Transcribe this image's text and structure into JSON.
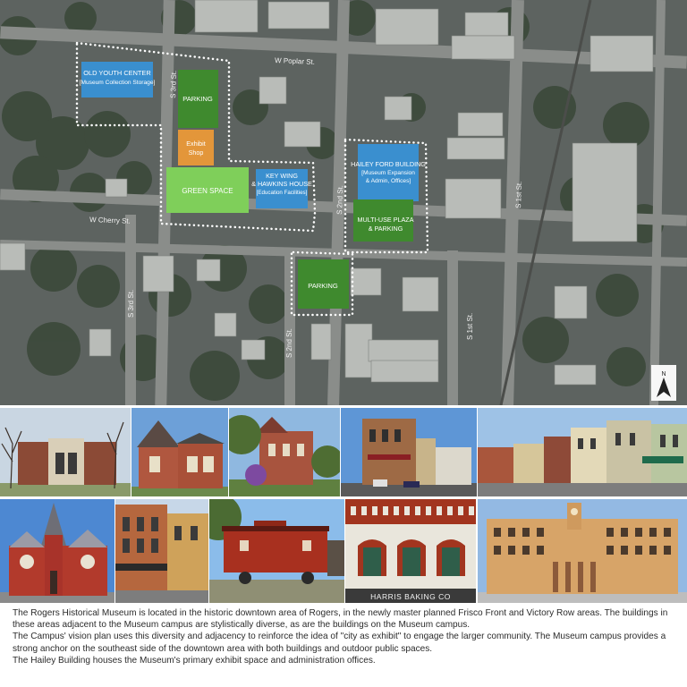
{
  "map": {
    "streets": {
      "poplar": "W Poplar St.",
      "cherry": "W Cherry St.",
      "third_upper": "S 3rd St.",
      "third_lower": "S 3rd St.",
      "second_upper": "S 2nd St.",
      "second_lower": "S 2nd St.",
      "first_mid": "S 1st St.",
      "first_right": "S 1st St."
    },
    "zones": {
      "old_youth_center": {
        "line1": "OLD YOUTH CENTER",
        "line2": "[Museum Collection Storage]",
        "color": "#3a8fcf"
      },
      "parking_north": {
        "line1": "PARKING",
        "color": "#3f8a2e"
      },
      "exhibit_shop": {
        "line1": "Exhibit",
        "line2": "Shop",
        "color": "#e3963a"
      },
      "green_space": {
        "line1": "GREEN SPACE",
        "color": "#7fcf5a"
      },
      "key_wing": {
        "line1": "KEY WING",
        "line2": "& HAWKINS HOUSE",
        "line3": "[Education Facilities]",
        "color": "#3a8fcf"
      },
      "hailey_ford": {
        "line1": "HAILEY FORD BUILDING",
        "line2": "[Museum Expansion",
        "line3": "& Admin, Offices]",
        "color": "#3a8fcf"
      },
      "multi_use": {
        "line1": "MULTI-USE PLAZA",
        "line2": "& PARKING",
        "color": "#3f8a2e"
      },
      "parking_south": {
        "line1": "PARKING",
        "color": "#3f8a2e"
      }
    },
    "north_arrow": "N"
  },
  "photos": [
    {
      "name": "photo-library-building"
    },
    {
      "name": "photo-brick-house"
    },
    {
      "name": "photo-victorian-mansion"
    },
    {
      "name": "photo-downtown-corner-building"
    },
    {
      "name": "photo-main-street-row"
    },
    {
      "name": "photo-brick-church"
    },
    {
      "name": "photo-brick-storefronts"
    },
    {
      "name": "photo-red-caboose"
    },
    {
      "name": "photo-harris-baking-facade",
      "sign": "HARRIS BAKING CO"
    },
    {
      "name": "photo-hotel-building"
    }
  ],
  "caption": {
    "p1": "The Rogers Historical Museum is located in the historic downtown area of Rogers, in the newly master planned Frisco Front and Victory Row areas. The buildings in these areas adjacent to the Museum campus are stylistically diverse, as are the buildings on the Museum campus.",
    "p2": "The Campus' vision plan uses this diversity and adjacency to reinforce the idea of \"city as exhibit\" to engage the larger community. The Museum campus provides a strong anchor on the southeast side of the downtown area with both buildings and outdoor public spaces.",
    "p3": "The Hailey Building houses the Museum's primary exhibit space and administration offices."
  }
}
